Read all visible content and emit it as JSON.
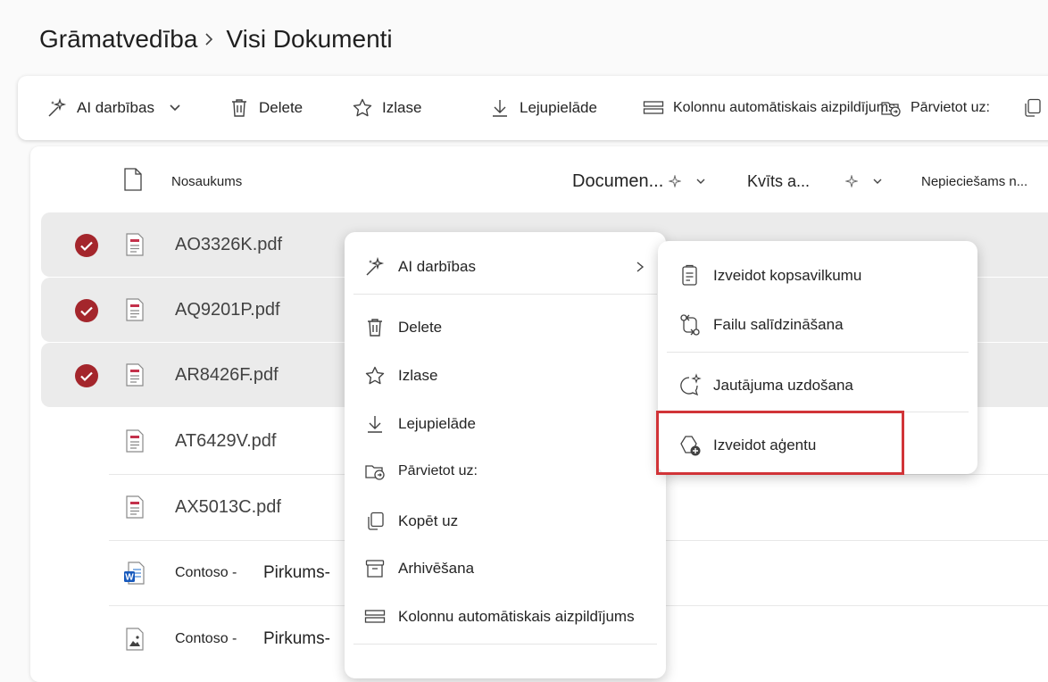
{
  "breadcrumb": {
    "parent": "Grāmatvedība",
    "current": "Visi Dokumenti"
  },
  "toolbar": {
    "ai_actions": "AI darbības",
    "delete": "Delete",
    "favorites": "Izlase",
    "download": "Lejupielāde",
    "autofill": "Kolonnu automātiskais aizpildījums",
    "move_to": "Pārvietot uz:"
  },
  "columns": {
    "name": "Nosaukums",
    "document": "Documen...",
    "receipt": "Kvīts a...",
    "required": "Nepieciešams n..."
  },
  "files": [
    {
      "name": "AO3326K.pdf",
      "type": "pdf",
      "selected": true
    },
    {
      "name": "AQ9201P.pdf",
      "type": "pdf",
      "selected": true
    },
    {
      "name": "AR8426F.pdf",
      "type": "pdf",
      "selected": true
    },
    {
      "name": "AT6429V.pdf",
      "type": "pdf",
      "selected": false
    },
    {
      "name": "AX5013C.pdf",
      "type": "pdf",
      "selected": false
    },
    {
      "name": "Contoso -",
      "name_suffix": "Pirkums-",
      "type": "word",
      "selected": false
    },
    {
      "name": "Contoso -",
      "name_suffix": "Pirkums-",
      "type": "image",
      "selected": false
    }
  ],
  "context_menu": {
    "ai_actions": "AI darbības",
    "delete": "Delete",
    "favorites": "Izlase",
    "download": "Lejupielāde",
    "move_to": "Pārvietot uz:",
    "copy_to": "Kopēt uz",
    "archive": "Arhivēšana",
    "autofill": "Kolonnu automātiskais aizpildījums"
  },
  "ai_submenu": {
    "summary": "Izveidot kopsavilkumu",
    "compare": "Failu salīdzināšana",
    "ask": "Jautājuma uzdošana",
    "create_agent": "Izveidot aģentu"
  },
  "colors": {
    "check": "#a4262c",
    "highlight": "#d13438",
    "pdf": "#c4314b",
    "word": "#185abd"
  }
}
